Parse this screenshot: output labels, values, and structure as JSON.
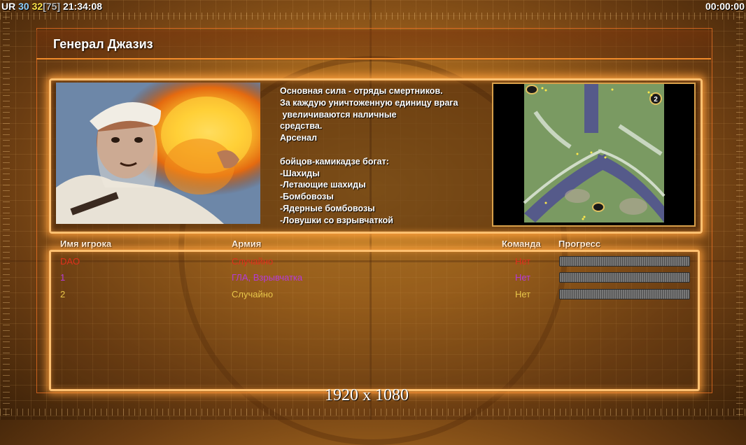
{
  "hud": {
    "prefix": "UR",
    "val1": "30",
    "val2": "32",
    "val3": "[75]",
    "clock": "21:34:08",
    "timer": "00:00:00"
  },
  "title": "Генерал Джазиз",
  "description": "Основная сила - отряды смертников.\nЗа каждую уничтоженную единицу врага\n увеличиваются наличные\nсредства.\nАрсенал\n\nбойцов-камикадзе богат:\n-Шахиды\n-Летающие шахиды\n-Бомбовозы\n-Ядерные бомбовозы\n-Ловушки со взрывчаткой",
  "minimap": {
    "start_marker": "2"
  },
  "columns": {
    "player": "Имя игрока",
    "army": "Армия",
    "team": "Команда",
    "progress": "Прогресс"
  },
  "players": [
    {
      "name": "DAO",
      "army": "Случайно",
      "team": "Нет",
      "color": "#e0301c",
      "progress": 1.0
    },
    {
      "name": "1",
      "army": "ГЛА, Взрывчатка",
      "team": "Нет",
      "color": "#b43ad8",
      "progress": 1.0
    },
    {
      "name": "2",
      "army": "Случайно",
      "team": "Нет",
      "color": "#e8c64a",
      "progress": 1.0
    }
  ],
  "resolution": "1920 x 1080"
}
